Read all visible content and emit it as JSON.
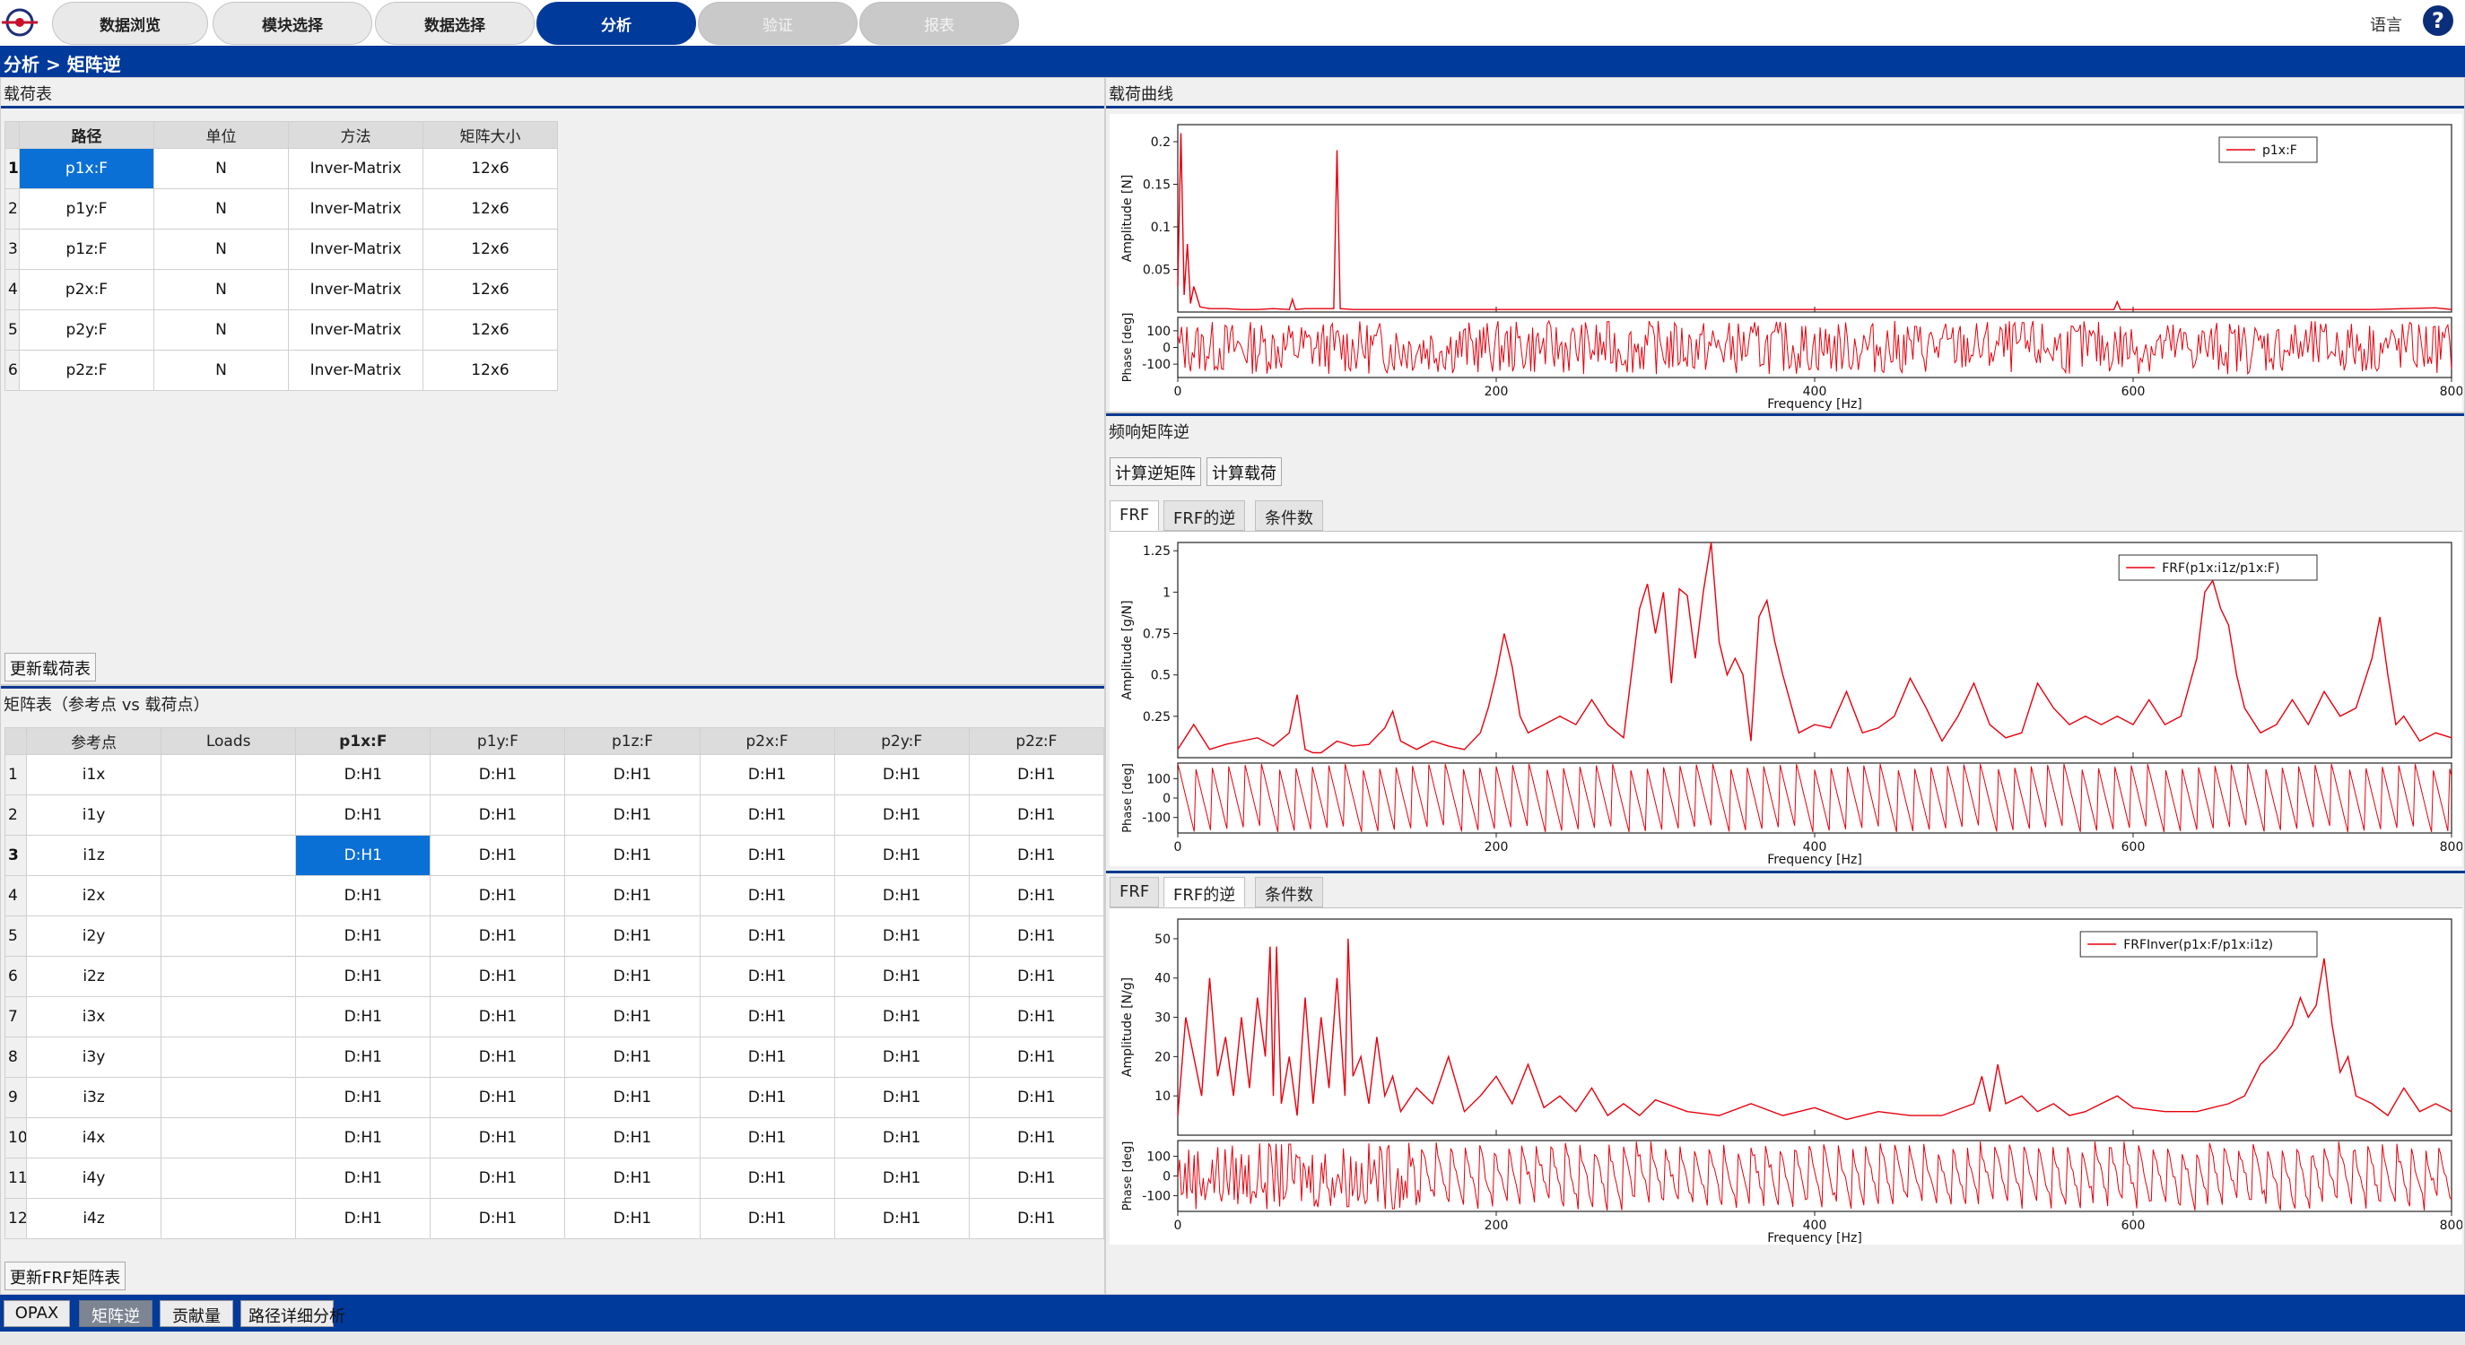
{
  "nav": {
    "tabs": [
      {
        "label": "数据浏览",
        "state": "normal"
      },
      {
        "label": "模块选择",
        "state": "normal"
      },
      {
        "label": "数据选择",
        "state": "normal"
      },
      {
        "label": "分析",
        "state": "active"
      },
      {
        "label": "验证",
        "state": "disabled"
      },
      {
        "label": "报表",
        "state": "disabled"
      }
    ],
    "language": "语言",
    "help": "?"
  },
  "breadcrumb": "分析 > 矩阵逆",
  "load_table": {
    "title": "载荷表",
    "columns": [
      "路径",
      "单位",
      "方法",
      "矩阵大小"
    ],
    "rows": [
      {
        "n": "1",
        "path": "p1x:F",
        "unit": "N",
        "method": "Inver-Matrix",
        "size": "12x6"
      },
      {
        "n": "2",
        "path": "p1y:F",
        "unit": "N",
        "method": "Inver-Matrix",
        "size": "12x6"
      },
      {
        "n": "3",
        "path": "p1z:F",
        "unit": "N",
        "method": "Inver-Matrix",
        "size": "12x6"
      },
      {
        "n": "4",
        "path": "p2x:F",
        "unit": "N",
        "method": "Inver-Matrix",
        "size": "12x6"
      },
      {
        "n": "5",
        "path": "p2y:F",
        "unit": "N",
        "method": "Inver-Matrix",
        "size": "12x6"
      },
      {
        "n": "6",
        "path": "p2z:F",
        "unit": "N",
        "method": "Inver-Matrix",
        "size": "12x6"
      }
    ],
    "update_button": "更新载荷表"
  },
  "matrix_table": {
    "title": "矩阵表（参考点 vs 载荷点）",
    "columns": [
      "参考点",
      "Loads",
      "p1x:F",
      "p1y:F",
      "p1z:F",
      "p2x:F",
      "p2y:F",
      "p2z:F"
    ],
    "rows": [
      {
        "n": "1",
        "ref": "i1x",
        "loads": "",
        "cells": [
          "D:H1",
          "D:H1",
          "D:H1",
          "D:H1",
          "D:H1",
          "D:H1"
        ]
      },
      {
        "n": "2",
        "ref": "i1y",
        "loads": "",
        "cells": [
          "D:H1",
          "D:H1",
          "D:H1",
          "D:H1",
          "D:H1",
          "D:H1"
        ]
      },
      {
        "n": "3",
        "ref": "i1z",
        "loads": "",
        "cells": [
          "D:H1",
          "D:H1",
          "D:H1",
          "D:H1",
          "D:H1",
          "D:H1"
        ]
      },
      {
        "n": "4",
        "ref": "i2x",
        "loads": "",
        "cells": [
          "D:H1",
          "D:H1",
          "D:H1",
          "D:H1",
          "D:H1",
          "D:H1"
        ]
      },
      {
        "n": "5",
        "ref": "i2y",
        "loads": "",
        "cells": [
          "D:H1",
          "D:H1",
          "D:H1",
          "D:H1",
          "D:H1",
          "D:H1"
        ]
      },
      {
        "n": "6",
        "ref": "i2z",
        "loads": "",
        "cells": [
          "D:H1",
          "D:H1",
          "D:H1",
          "D:H1",
          "D:H1",
          "D:H1"
        ]
      },
      {
        "n": "7",
        "ref": "i3x",
        "loads": "",
        "cells": [
          "D:H1",
          "D:H1",
          "D:H1",
          "D:H1",
          "D:H1",
          "D:H1"
        ]
      },
      {
        "n": "8",
        "ref": "i3y",
        "loads": "",
        "cells": [
          "D:H1",
          "D:H1",
          "D:H1",
          "D:H1",
          "D:H1",
          "D:H1"
        ]
      },
      {
        "n": "9",
        "ref": "i3z",
        "loads": "",
        "cells": [
          "D:H1",
          "D:H1",
          "D:H1",
          "D:H1",
          "D:H1",
          "D:H1"
        ]
      },
      {
        "n": "10",
        "ref": "i4x",
        "loads": "",
        "cells": [
          "D:H1",
          "D:H1",
          "D:H1",
          "D:H1",
          "D:H1",
          "D:H1"
        ]
      },
      {
        "n": "11",
        "ref": "i4y",
        "loads": "",
        "cells": [
          "D:H1",
          "D:H1",
          "D:H1",
          "D:H1",
          "D:H1",
          "D:H1"
        ]
      },
      {
        "n": "12",
        "ref": "i4z",
        "loads": "",
        "cells": [
          "D:H1",
          "D:H1",
          "D:H1",
          "D:H1",
          "D:H1",
          "D:H1"
        ]
      }
    ],
    "update_button": "更新FRF矩阵表"
  },
  "load_curve": {
    "title": "载荷曲线"
  },
  "frf_panel": {
    "title": "频响矩阵逆",
    "buttons": [
      "计算逆矩阵",
      "计算载荷"
    ],
    "tabs_top": [
      "FRF",
      "FRF的逆",
      "条件数"
    ],
    "tabs_bottom": [
      "FRF",
      "FRF的逆",
      "条件数"
    ]
  },
  "colors": {
    "accent": "#003a9b",
    "selection": "#0a70d6",
    "trace": "#e8000d"
  },
  "chart_data": [
    {
      "type": "line",
      "name": "load-curve",
      "legend": "p1x:F",
      "xlabel": "Frequency [Hz]",
      "xlim": [
        0,
        800
      ],
      "xticks": [
        "0",
        "200",
        "400",
        "600",
        "800"
      ],
      "amp": {
        "ylabel": "Amplitude [N]",
        "yticks": [
          "0.2",
          "0.15",
          "0.1",
          "0.05"
        ],
        "ylim": [
          0,
          0.22
        ],
        "x": [
          0,
          2,
          4,
          6,
          8,
          10,
          14,
          20,
          30,
          40,
          50,
          60,
          70,
          72,
          74,
          80,
          90,
          98,
          100,
          102,
          110,
          120,
          150,
          200,
          250,
          300,
          350,
          400,
          450,
          500,
          550,
          588,
          590,
          592,
          600,
          650,
          700,
          750,
          790,
          800
        ],
        "y": [
          0.03,
          0.21,
          0.02,
          0.08,
          0.01,
          0.03,
          0.006,
          0.004,
          0.004,
          0.003,
          0.003,
          0.004,
          0.003,
          0.015,
          0.003,
          0.004,
          0.004,
          0.004,
          0.19,
          0.004,
          0.003,
          0.003,
          0.003,
          0.003,
          0.003,
          0.003,
          0.003,
          0.003,
          0.003,
          0.003,
          0.003,
          0.003,
          0.012,
          0.003,
          0.003,
          0.003,
          0.003,
          0.003,
          0.005,
          0.003
        ]
      },
      "phase": {
        "ylabel": "Phase [deg]",
        "yticks": [
          "100",
          "0",
          "-100"
        ],
        "ylim": [
          -180,
          180
        ],
        "pattern": "noise"
      }
    },
    {
      "type": "line",
      "name": "frf",
      "legend": "FRF(p1x:i1z/p1x:F)",
      "xlabel": "Frequency [Hz]",
      "xlim": [
        0,
        800
      ],
      "xticks": [
        "0",
        "200",
        "400",
        "600",
        "800"
      ],
      "amp": {
        "ylabel": "Amplitude [g/N]",
        "yticks": [
          "1.25",
          "1",
          "0.75",
          "0.5",
          "0.25"
        ],
        "ylim": [
          0,
          1.3
        ],
        "x": [
          0,
          10,
          20,
          30,
          40,
          50,
          60,
          70,
          75,
          80,
          85,
          90,
          100,
          110,
          120,
          130,
          135,
          140,
          150,
          160,
          170,
          180,
          190,
          195,
          200,
          205,
          210,
          215,
          220,
          230,
          240,
          250,
          260,
          270,
          280,
          290,
          295,
          300,
          305,
          310,
          315,
          320,
          325,
          330,
          335,
          340,
          345,
          350,
          355,
          360,
          365,
          370,
          375,
          380,
          390,
          400,
          410,
          420,
          430,
          440,
          450,
          460,
          470,
          480,
          490,
          500,
          510,
          520,
          530,
          540,
          550,
          560,
          570,
          580,
          590,
          600,
          610,
          620,
          630,
          640,
          645,
          650,
          655,
          660,
          665,
          670,
          680,
          690,
          700,
          710,
          720,
          730,
          740,
          750,
          755,
          760,
          765,
          770,
          780,
          790,
          800
        ],
        "y": [
          0.05,
          0.2,
          0.05,
          0.08,
          0.1,
          0.12,
          0.07,
          0.15,
          0.38,
          0.05,
          0.03,
          0.03,
          0.1,
          0.07,
          0.08,
          0.18,
          0.28,
          0.1,
          0.05,
          0.1,
          0.07,
          0.05,
          0.15,
          0.3,
          0.5,
          0.75,
          0.55,
          0.25,
          0.15,
          0.2,
          0.25,
          0.2,
          0.35,
          0.2,
          0.12,
          0.9,
          1.05,
          0.75,
          1.0,
          0.45,
          1.02,
          0.98,
          0.6,
          1.0,
          1.3,
          0.7,
          0.5,
          0.6,
          0.5,
          0.1,
          0.85,
          0.95,
          0.7,
          0.5,
          0.15,
          0.2,
          0.18,
          0.4,
          0.15,
          0.18,
          0.25,
          0.48,
          0.3,
          0.1,
          0.25,
          0.45,
          0.2,
          0.12,
          0.15,
          0.45,
          0.3,
          0.2,
          0.25,
          0.2,
          0.25,
          0.2,
          0.35,
          0.2,
          0.25,
          0.6,
          1.0,
          1.07,
          0.9,
          0.8,
          0.5,
          0.3,
          0.15,
          0.2,
          0.35,
          0.2,
          0.4,
          0.25,
          0.3,
          0.6,
          0.85,
          0.5,
          0.2,
          0.25,
          0.1,
          0.15,
          0.12
        ]
      },
      "phase": {
        "ylabel": "Phase [deg]",
        "yticks": [
          "100",
          "0",
          "-100"
        ],
        "ylim": [
          -180,
          180
        ],
        "pattern": "sawtooth"
      }
    },
    {
      "type": "line",
      "name": "frf-inverse",
      "legend": "FRFInver(p1x:F/p1x:i1z)",
      "xlabel": "Frequency [Hz]",
      "xlim": [
        0,
        800
      ],
      "xticks": [
        "0",
        "200",
        "400",
        "600",
        "800"
      ],
      "amp": {
        "ylabel": "Amplitude [N/g]",
        "yticks": [
          "50",
          "40",
          "30",
          "20",
          "10"
        ],
        "ylim": [
          0,
          55
        ],
        "x": [
          0,
          5,
          10,
          15,
          20,
          25,
          30,
          35,
          40,
          45,
          50,
          55,
          58,
          60,
          62,
          65,
          70,
          75,
          80,
          85,
          90,
          95,
          100,
          105,
          107,
          110,
          115,
          120,
          125,
          130,
          135,
          140,
          150,
          160,
          170,
          180,
          190,
          200,
          210,
          220,
          230,
          240,
          250,
          260,
          270,
          280,
          290,
          300,
          320,
          340,
          360,
          380,
          400,
          420,
          440,
          460,
          480,
          500,
          505,
          510,
          515,
          520,
          530,
          540,
          550,
          560,
          570,
          580,
          590,
          600,
          620,
          640,
          660,
          670,
          680,
          690,
          700,
          705,
          710,
          715,
          720,
          725,
          730,
          735,
          740,
          750,
          760,
          770,
          780,
          790,
          800
        ],
        "y": [
          5,
          30,
          20,
          10,
          40,
          15,
          25,
          10,
          30,
          12,
          35,
          20,
          48,
          10,
          48,
          8,
          20,
          5,
          35,
          8,
          30,
          12,
          40,
          10,
          50,
          15,
          20,
          8,
          25,
          10,
          15,
          6,
          12,
          8,
          20,
          6,
          10,
          15,
          8,
          18,
          7,
          10,
          6,
          12,
          5,
          8,
          5,
          9,
          6,
          5,
          8,
          5,
          7,
          4,
          6,
          5,
          5,
          8,
          15,
          6,
          18,
          8,
          10,
          6,
          8,
          5,
          6,
          8,
          10,
          7,
          6,
          6,
          8,
          10,
          18,
          22,
          28,
          35,
          30,
          33,
          45,
          28,
          16,
          20,
          10,
          8,
          5,
          12,
          6,
          8,
          6
        ]
      },
      "phase": {
        "ylabel": "Phase [deg]",
        "yticks": [
          "100",
          "0",
          "-100"
        ],
        "ylim": [
          -180,
          180
        ],
        "pattern": "sawnoise"
      }
    }
  ],
  "bottom_tabs": [
    "OPAX",
    "矩阵逆",
    "贡献量",
    "路径详细分析"
  ]
}
